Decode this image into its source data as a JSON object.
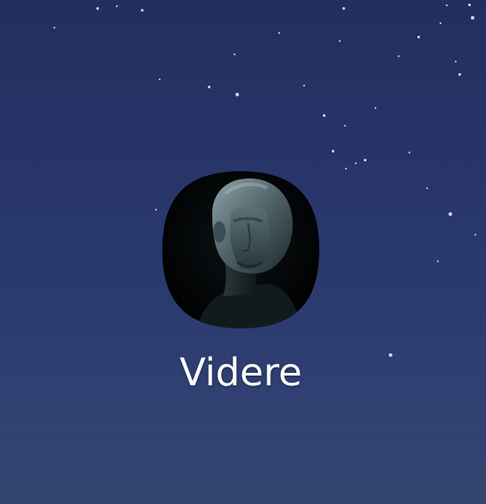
{
  "home_screen": {
    "app": {
      "label": "Videre",
      "icon": "mannequin-head-icon"
    }
  }
}
